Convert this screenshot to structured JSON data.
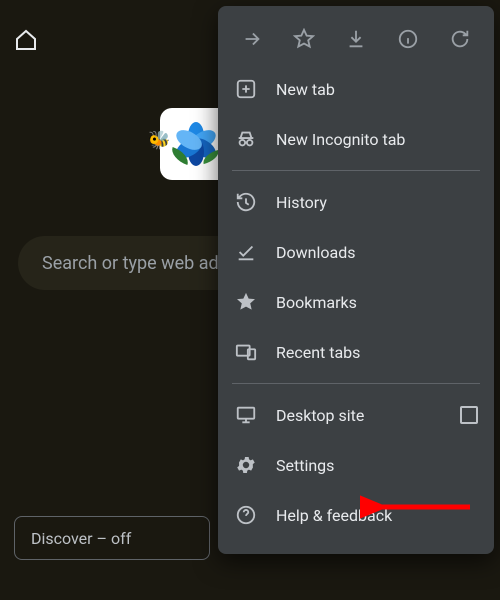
{
  "toolbar": {
    "home_icon": "home"
  },
  "search": {
    "placeholder": "Search or type web address"
  },
  "discover": {
    "label": "Discover – off"
  },
  "menu": {
    "top_icons": [
      "forward",
      "star",
      "download",
      "info",
      "refresh"
    ],
    "groups": [
      [
        {
          "icon": "plus-box",
          "label": "New tab"
        },
        {
          "icon": "incognito",
          "label": "New Incognito tab"
        }
      ],
      [
        {
          "icon": "history",
          "label": "History"
        },
        {
          "icon": "check-underline",
          "label": "Downloads"
        },
        {
          "icon": "star-fill",
          "label": "Bookmarks"
        },
        {
          "icon": "devices",
          "label": "Recent tabs"
        }
      ],
      [
        {
          "icon": "monitor",
          "label": "Desktop site",
          "checkbox": true
        },
        {
          "icon": "gear",
          "label": "Settings"
        },
        {
          "icon": "help",
          "label": "Help & feedback"
        }
      ]
    ]
  },
  "annotation": {
    "arrow_color": "#ff0000",
    "target": "settings"
  }
}
